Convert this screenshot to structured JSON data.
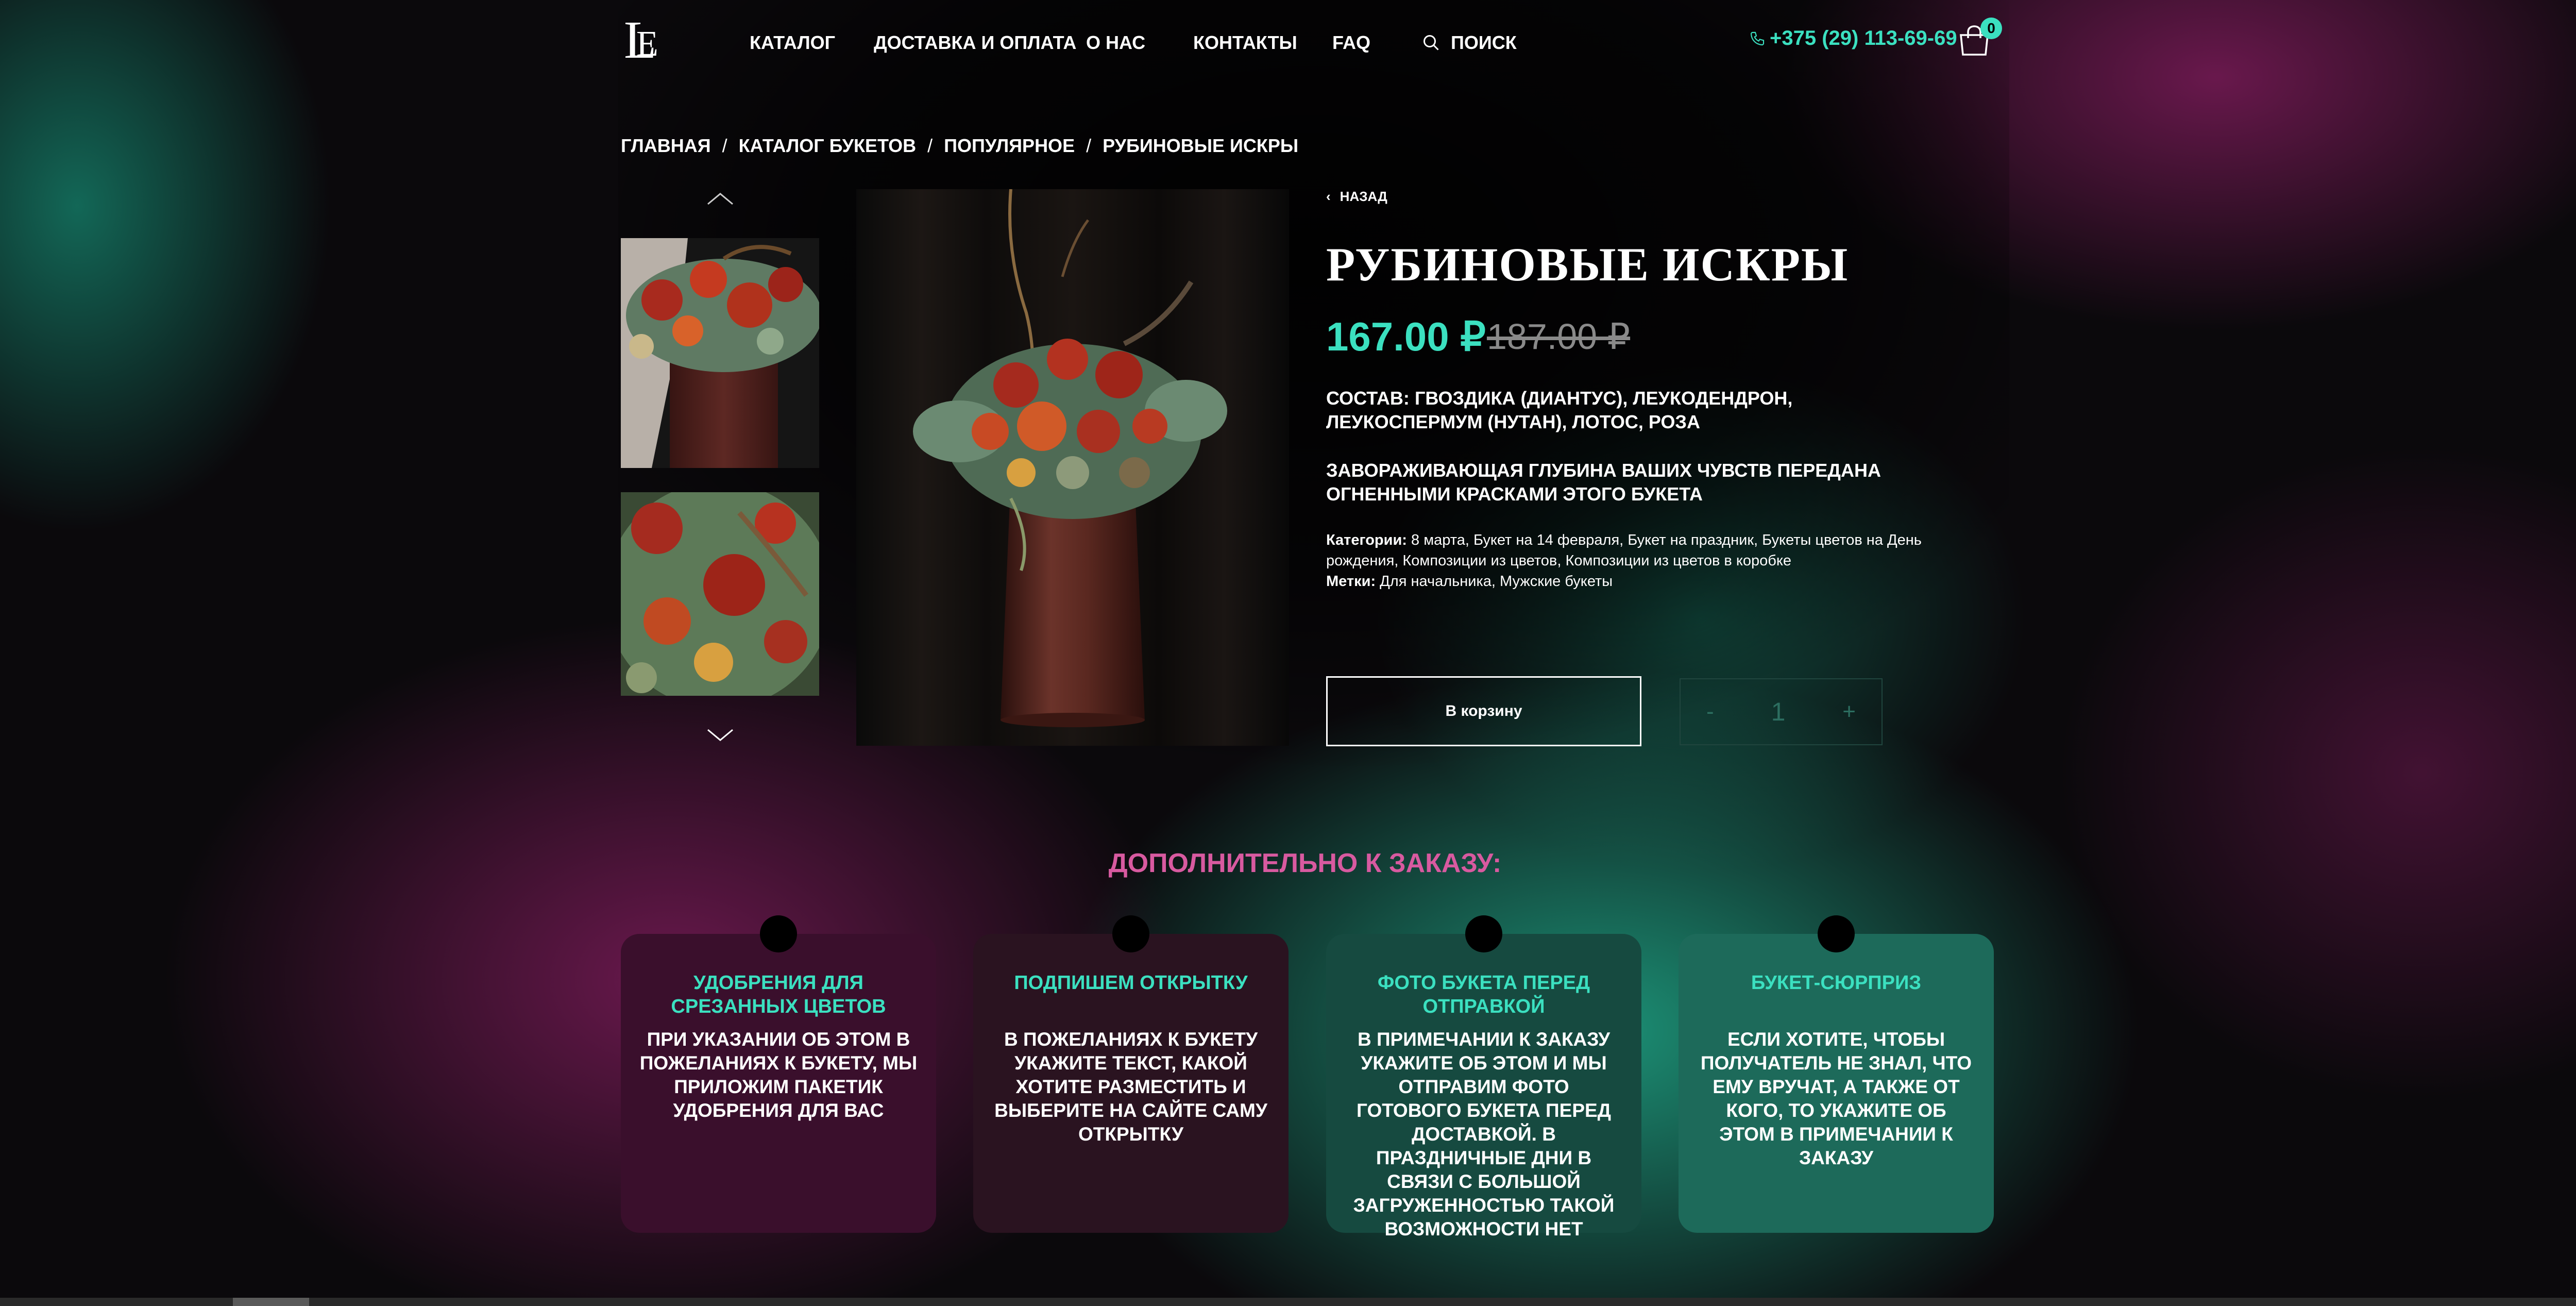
{
  "header": {
    "nav": [
      "КАТАЛОГ",
      "ДОСТАВКА И ОПЛАТА",
      "О НАС",
      "КОНТАКТЫ",
      "FAQ"
    ],
    "search_label": "ПОИСК",
    "phone": "+375 (29) 113-69-69",
    "cart_count": "0"
  },
  "breadcrumb": {
    "items": [
      "ГЛАВНАЯ",
      "КАТАЛОГ БУКЕТОВ",
      "ПОПУЛЯРНОЕ",
      "РУБИНОВЫЕ ИСКРЫ"
    ],
    "separator": "/"
  },
  "product": {
    "back_label": "НАЗАД",
    "back_icon": "chevron-left-icon",
    "title": "РУБИНОВЫЕ ИСКРЫ",
    "price": "167.00 ₽",
    "old_price": "187.00 ₽",
    "composition_label": "СОСТАВ:",
    "composition": "ГВОЗДИКА (ДИАНТУС), ЛЕУКОДЕНДРОН, ЛЕУКОСПЕРМУМ (НУТАН), ЛОТОС, РОЗА",
    "tagline": "ЗАВОРАЖИВАЮЩАЯ ГЛУБИНА ВАШИХ ЧУВСТВ ПЕРЕДАНА ОГНЕННЫМИ КРАСКАМИ ЭТОГО БУКЕТА",
    "categories_label": "Категории:",
    "categories": "8 марта, Букет на 14 февраля, Букет на праздник, Букеты цветов на День рождения, Композиции из цветов, Композиции из цветов в коробке",
    "tags_label": "Метки:",
    "tags": "Для начальника, Мужские букеты",
    "add_to_cart": "В корзину",
    "qty_minus": "-",
    "qty_value": "1",
    "qty_plus": "+"
  },
  "extras": {
    "title": "ДОПОЛНИТЕЛЬНО К ЗАКАЗУ:",
    "cards": [
      {
        "title": "УДОБРЕНИЯ ДЛЯ СРЕЗАННЫХ ЦВЕТОВ",
        "text": "ПРИ УКАЗАНИИ ОБ ЭТОМ В ПОЖЕЛАНИЯХ К БУКЕТУ, МЫ ПРИЛОЖИМ ПАКЕТИК УДОБРЕНИЯ ДЛЯ ВАС",
        "bg": "#3a0f2c"
      },
      {
        "title": "ПОДПИШЕМ ОТКРЫТКУ",
        "text": "В ПОЖЕЛАНИЯХ К БУКЕТУ УКАЖИТЕ ТЕКСТ, КАКОЙ ХОТИТЕ РАЗМЕСТИТЬ И ВЫБЕРИТЕ НА САЙТЕ САМУ ОТКРЫТКУ",
        "bg": "#2a1320"
      },
      {
        "title": "ФОТО БУКЕТА ПЕРЕД ОТПРАВКОЙ",
        "text": "В ПРИМЕЧАНИИ К ЗАКАЗУ УКАЖИТЕ ОБ ЭТОМ И МЫ ОТПРАВИМ ФОТО ГОТОВОГО БУКЕТА ПЕРЕД ДОСТАВКОЙ. В ПРАЗДНИЧНЫЕ ДНИ В СВЯЗИ С БОЛЬШОЙ ЗАГРУЖЕННОСТЬЮ ТАКОЙ ВОЗМОЖНОСТИ НЕТ",
        "bg": "#164a40"
      },
      {
        "title": "БУКЕТ-СЮРПРИЗ",
        "text": "ЕСЛИ ХОТИТЕ, ЧТОБЫ ПОЛУЧАТЕЛЬ НЕ ЗНАЛ, ЧТО ЕМУ ВРУЧАТ, А ТАКЖЕ ОТ КОГО, ТО УКАЖИТЕ ОБ ЭТОМ В ПРИМЕЧАНИИ К ЗАКАЗУ",
        "bg": "#1d6a5a"
      }
    ]
  },
  "colors": {
    "accent": "#3be0c0",
    "extras_title": "#d85aa0",
    "old_price": "#8a8a8a"
  }
}
